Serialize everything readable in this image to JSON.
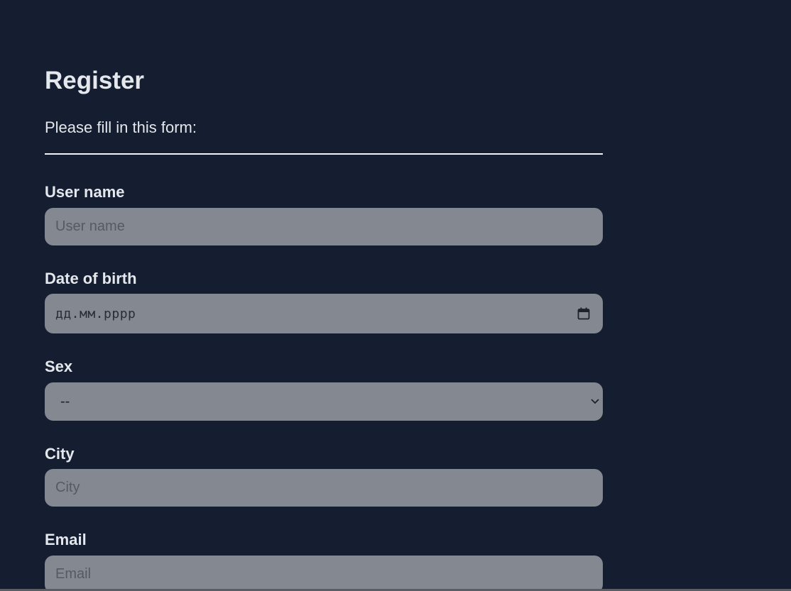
{
  "form": {
    "title": "Register",
    "intro": "Please fill in this form:",
    "fields": {
      "username": {
        "label": "User name",
        "placeholder": "User name"
      },
      "dob": {
        "label": "Date of birth",
        "value": "дд.мм.рррр",
        "icon": "calendar-icon"
      },
      "sex": {
        "label": "Sex",
        "selected": "--",
        "icon": "chevron-down-icon"
      },
      "city": {
        "label": "City",
        "placeholder": "City"
      },
      "email": {
        "label": "Email",
        "placeholder": "Email"
      }
    }
  },
  "colors": {
    "background": "#151d30",
    "field_bg": "#848891",
    "text": "#e4e7eb"
  }
}
